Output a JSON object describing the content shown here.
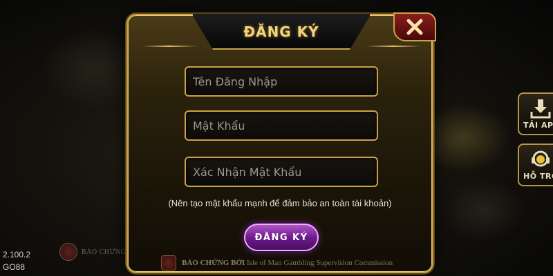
{
  "modal": {
    "title": "ĐĂNG KÝ",
    "close_icon": "close-icon",
    "fields": {
      "username_placeholder": "Tên Đăng Nhập",
      "password_placeholder": "Mật Khẩu",
      "confirm_placeholder": "Xác Nhận Mật Khẩu"
    },
    "hint": "(Nên tạo mật khẩu mạnh để đảm bảo an toàn tài khoản)",
    "submit_label": "ĐĂNG KÝ",
    "footer_cert": {
      "name": "BẢO CHỨNG BỞI",
      "sub": "Isle of Man Gambling Supervision Commission"
    }
  },
  "side": {
    "download_label": "TẢI APP",
    "support_label": "HỖ TRỢ"
  },
  "app": {
    "version": "2.100.2",
    "brand": "GO88",
    "cert_label": "BẢO CHỨNG"
  },
  "colors": {
    "gold": "#c9a24a",
    "title_gold": "#f3d37a",
    "close_red": "#8a1d1d",
    "submit_purple": "#6e1c8c"
  }
}
